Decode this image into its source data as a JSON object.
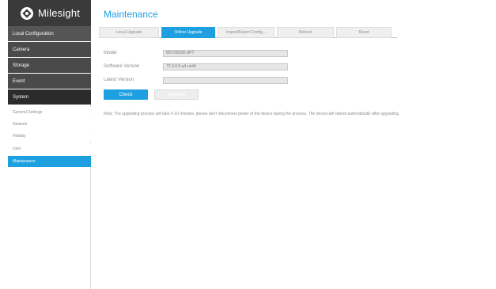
{
  "brand": {
    "name": "Milesight"
  },
  "sidebar": {
    "local_configuration": "Local Configuration",
    "camera": "Camera",
    "storage": "Storage",
    "event": "Event",
    "system": "System",
    "sub_items": [
      "General Settings",
      "Network",
      "Holiday",
      "User",
      "Maintenance"
    ]
  },
  "main": {
    "title": "Maintenance",
    "tabs": [
      "Local Upgrade",
      "Online Upgrade",
      "Import/Export Config...",
      "Reboot",
      "Reset"
    ],
    "active_tab": "Online Upgrade",
    "fields": {
      "model_label": "Model",
      "model_value": "MS-N5008-UPT",
      "software_version_label": "Software Version",
      "software_version_value": "72.9.0.9-a4-unit4",
      "latest_version_label": "Latest Version",
      "latest_version_value": ""
    },
    "buttons": {
      "check": "Check",
      "upgrade": "Upgrade"
    },
    "note": "Note: The upgrading process will take 5-10 minutes, please don't disconnect power of the device during the process. The device will reboot automatically after upgrading."
  },
  "colors": {
    "accent": "#1e9fe0",
    "sidebar_dark": "#4a4a4a",
    "logo_bg": "#3a3a3a"
  }
}
